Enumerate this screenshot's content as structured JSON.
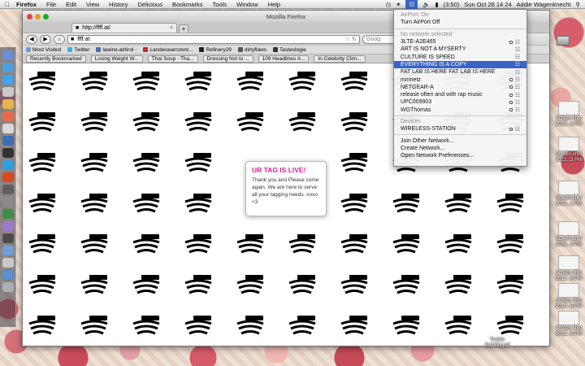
{
  "menubar": {
    "app_name": "Firefox",
    "items": [
      "File",
      "Edit",
      "View",
      "History",
      "Delicious",
      "Bookmarks",
      "Tools",
      "Window",
      "Help"
    ],
    "battery": "(3:50)",
    "datetime": "Sun Oct 28  14 24",
    "user": "Addie Wagenknecht"
  },
  "window": {
    "title": "Mozilla Firefox",
    "tab_label": "http://ffff.at/",
    "url": "ffff.at",
    "search_placeholder": "Goog"
  },
  "bookmarks": [
    "Most Visited",
    "Twitter",
    "lawine.at/tirol -",
    "Landeswarnzent...",
    "Refinery29",
    "dirtyflaws",
    "Tasteologie"
  ],
  "toolbar2": [
    "Recently Bookmarked",
    "Losing Weight W...",
    "Thai Soup - Tha...",
    "Dressing Not to ...",
    "109 Headlines A...",
    "In Celebrity Clim..."
  ],
  "popup": {
    "headline": "UR TAG IS LIVE!",
    "body": "Thank you and Please come again. We are here to serve all your tagging needs. xoxo <3"
  },
  "airport_menu": {
    "status": "AirPort: On",
    "toggle": "Turn AirPort Off",
    "no_network": "No network selected",
    "networks": [
      {
        "name": "3LTE-A2E465",
        "locked": true
      },
      {
        "name": "ART IS NOT A MYSERTY",
        "locked": false
      },
      {
        "name": "CULTURE IS SPEED",
        "locked": false
      },
      {
        "name": "EVERYTHING IS A COPY",
        "locked": false,
        "selected": true
      },
      {
        "name": "FAT LAB IS HERE FAT LAB IS HERE",
        "locked": false
      },
      {
        "name": "mmnetz",
        "locked": true
      },
      {
        "name": "NETGEAR-A",
        "locked": true
      },
      {
        "name": "release often and with rap music",
        "locked": true
      },
      {
        "name": "UPC009903",
        "locked": true
      },
      {
        "name": "WGThomas",
        "locked": true
      }
    ],
    "devices_header": "Devices",
    "device": "WIRELESS-STATION",
    "actions": [
      "Join Other Network...",
      "Create Network...",
      "Open Network Preferences..."
    ]
  },
  "desktop_items": [
    "Screen shot 2012...2 PM",
    "Screen shot 2012...1 PM",
    "Screen shot 2012...8 PM",
    "Screen shot 2012...6 PM",
    "Screen shot 2012...6 PM",
    "Screen shot 2012...5 PM",
    "Screen shot 2012...4 PM",
    "Trunks Stability.pdf"
  ],
  "colors": {
    "popup_headline": "#e0209b",
    "selection": "#3a63c6",
    "menubar": "#e6e6e6"
  }
}
